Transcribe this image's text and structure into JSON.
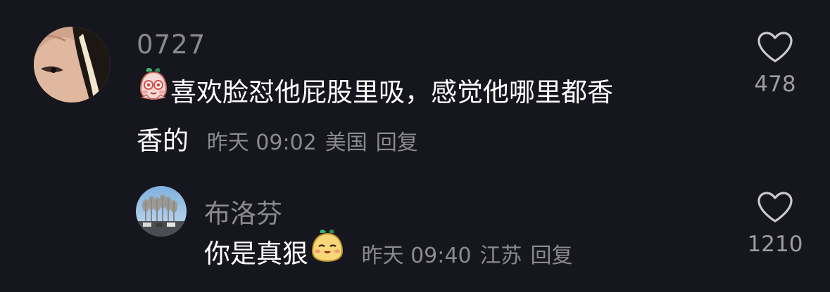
{
  "comments": [
    {
      "username": "0727",
      "text_before_sticker": "",
      "sticker_icon": "blush-mochi-sticker",
      "text": "喜欢脸怼他屁股里吸，感觉他哪里都香",
      "text_line2": "香的",
      "timestamp": "昨天 09:02",
      "location": "美国",
      "reply_label": "回复",
      "like_count": "478",
      "like_icon": "heart-outline-icon"
    },
    {
      "username": "布洛芬",
      "text": "你是真狠",
      "sticker_icon": "smug-mochi-sticker",
      "timestamp": "昨天 09:40",
      "location": "江苏",
      "reply_label": "回复",
      "like_count": "1210",
      "like_icon": "heart-outline-icon"
    }
  ],
  "colors": {
    "background": "#16161e",
    "username": "#8a8a90",
    "text": "#ffffff",
    "meta": "#8a8a90",
    "like_count": "#9c9ca2"
  }
}
